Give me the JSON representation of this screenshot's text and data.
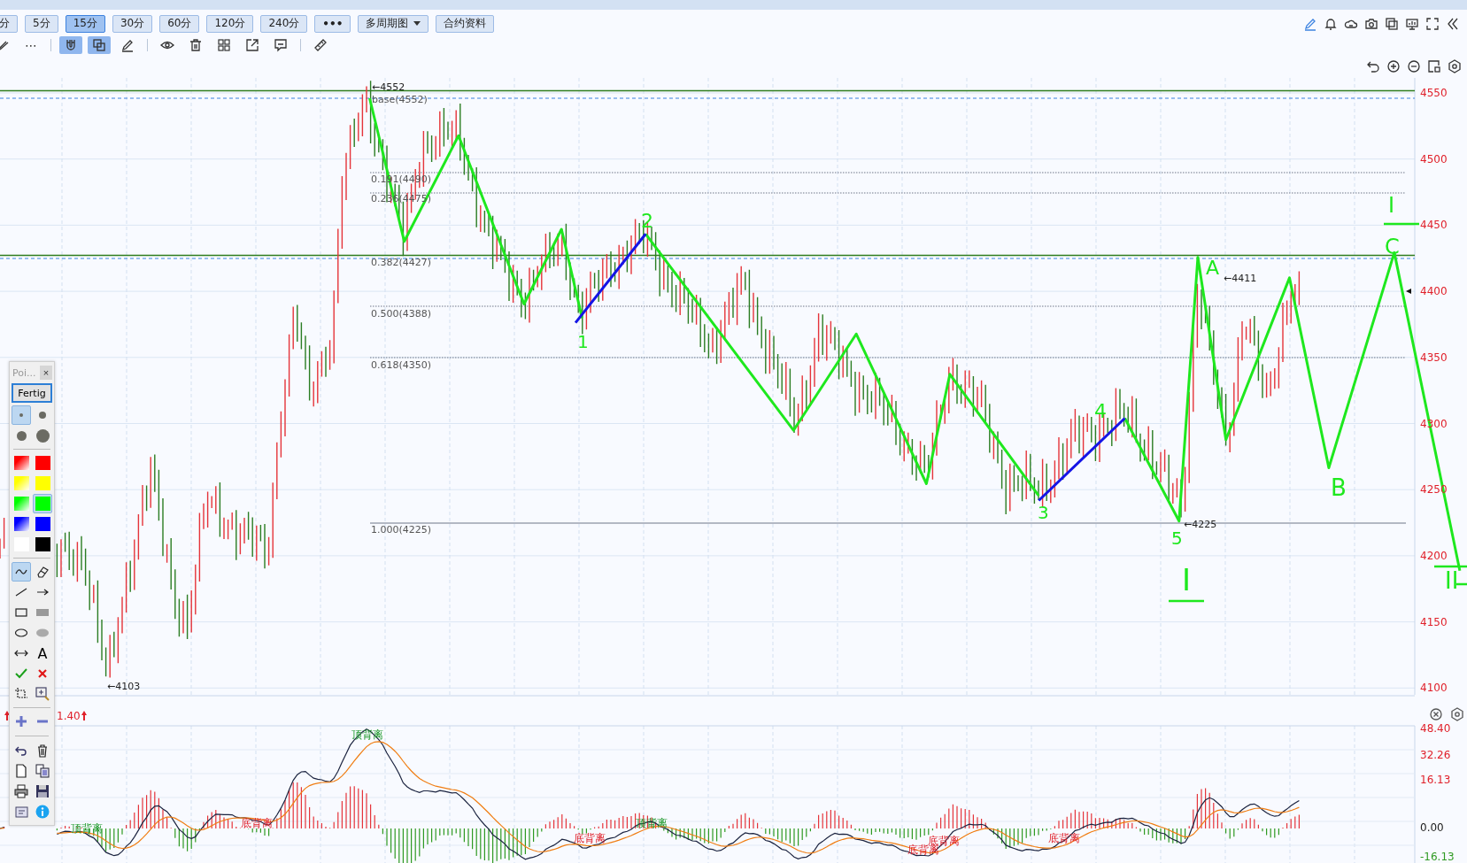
{
  "toolbar": {
    "periods": [
      {
        "label": "分",
        "selected": false
      },
      {
        "label": "5分",
        "selected": false
      },
      {
        "label": "15分",
        "selected": true
      },
      {
        "label": "30分",
        "selected": false
      },
      {
        "label": "60分",
        "selected": false
      },
      {
        "label": "120分",
        "selected": false
      },
      {
        "label": "240分",
        "selected": false
      }
    ],
    "more": "•••",
    "multi_period": "多周期图",
    "contract_info": "合约资料",
    "right_icons": [
      {
        "kind": "pencil"
      },
      {
        "kind": "bell"
      },
      {
        "kind": "cloud"
      },
      {
        "kind": "camera"
      },
      {
        "kind": "copy"
      },
      {
        "kind": "monitor"
      },
      {
        "kind": "fullscreen"
      },
      {
        "kind": "collapse"
      }
    ]
  },
  "drawing_toolbar": [
    {
      "kind": "pen-cut",
      "selected": false
    },
    {
      "kind": "dots",
      "label": "⋯",
      "selected": false
    },
    {
      "kind": "magnet",
      "selected": true
    },
    {
      "kind": "layers",
      "selected": true
    },
    {
      "kind": "pencil",
      "selected": false
    },
    {
      "kind": "eye",
      "selected": false
    },
    {
      "kind": "trash",
      "selected": false
    },
    {
      "kind": "grid",
      "selected": false
    },
    {
      "kind": "external",
      "selected": false
    },
    {
      "kind": "comment",
      "selected": false
    },
    {
      "kind": "ruler",
      "selected": false
    }
  ],
  "chart_tools": [
    {
      "kind": "undo"
    },
    {
      "kind": "zoom-in"
    },
    {
      "kind": "zoom-out"
    },
    {
      "kind": "window"
    },
    {
      "kind": "settings"
    }
  ],
  "price_axis": [
    "4550",
    "4500",
    "4450",
    "4400",
    "4350",
    "4300",
    "4250",
    "4200",
    "4150",
    "4100"
  ],
  "fib_levels": [
    "base(4552)",
    "0.191(4490)",
    "0.236(4475)",
    "0.382(4427)",
    "0.500(4388)",
    "0.618(4350)",
    "1.000(4225)"
  ],
  "extremes": [
    "←4552",
    "←4411",
    "←4225",
    "←4103"
  ],
  "hand_marks": [
    "1",
    "2",
    "3",
    "4",
    "5",
    "A",
    "B",
    "C",
    "I",
    "I",
    "II"
  ],
  "indicator": {
    "value": "1.40",
    "axis": [
      "48.40",
      "32.26",
      "16.13",
      "0.00",
      "-16.13"
    ],
    "divergences": [
      {
        "label": "顶背离",
        "kind": "top"
      },
      {
        "label": "底背离",
        "kind": "bottom"
      },
      {
        "label": "顶背离",
        "kind": "top"
      },
      {
        "label": "底背离",
        "kind": "bottom"
      },
      {
        "label": "顶背离",
        "kind": "top"
      },
      {
        "label": "底背离",
        "kind": "bottom"
      },
      {
        "label": "底背离",
        "kind": "bottom"
      },
      {
        "label": "底背离",
        "kind": "bottom"
      }
    ]
  },
  "palette": {
    "title": "Poi...",
    "close": "×",
    "done": "Fertig",
    "sizes": [
      {
        "selected": true
      },
      {
        "selected": false
      },
      {
        "selected": false
      },
      {
        "selected": false
      }
    ],
    "colors": [
      {
        "color": "#ff0000",
        "kind": "gradient",
        "selected": false
      },
      {
        "color": "#ff0000",
        "kind": "solid",
        "selected": false
      },
      {
        "color": "#ffff00",
        "kind": "gradient",
        "selected": false
      },
      {
        "color": "#ffff00",
        "kind": "solid",
        "selected": false
      },
      {
        "color": "#00ff00",
        "kind": "gradient",
        "selected": false
      },
      {
        "color": "#00ff00",
        "kind": "solid",
        "selected": true
      },
      {
        "color": "#0000ff",
        "kind": "gradient",
        "selected": false
      },
      {
        "color": "#0000ff",
        "kind": "solid",
        "selected": false
      },
      {
        "color": "#ffffff",
        "kind": "solid",
        "selected": false
      },
      {
        "color": "#000000",
        "kind": "solid",
        "selected": false
      }
    ],
    "tools": [
      {
        "kind": "freehand",
        "selected": true
      },
      {
        "kind": "eraser",
        "selected": false
      },
      {
        "kind": "line",
        "selected": false
      },
      {
        "kind": "arrow",
        "selected": false
      },
      {
        "kind": "rect",
        "selected": false
      },
      {
        "kind": "filled-rect",
        "selected": false
      },
      {
        "kind": "ellipse",
        "selected": false
      },
      {
        "kind": "filled-ellipse",
        "selected": false
      },
      {
        "kind": "double-arrow",
        "selected": false
      },
      {
        "kind": "text",
        "label": "A",
        "selected": false
      },
      {
        "kind": "check",
        "selected": false
      },
      {
        "kind": "cross",
        "selected": false
      },
      {
        "kind": "crop",
        "selected": false
      },
      {
        "kind": "zoom",
        "selected": false
      }
    ],
    "actions": [
      {
        "kind": "plus"
      },
      {
        "kind": "minus"
      },
      {
        "kind": "undo"
      },
      {
        "kind": "trash"
      },
      {
        "kind": "new"
      },
      {
        "kind": "copy"
      },
      {
        "kind": "print"
      },
      {
        "kind": "save"
      },
      {
        "kind": "card"
      },
      {
        "kind": "info"
      }
    ]
  }
}
